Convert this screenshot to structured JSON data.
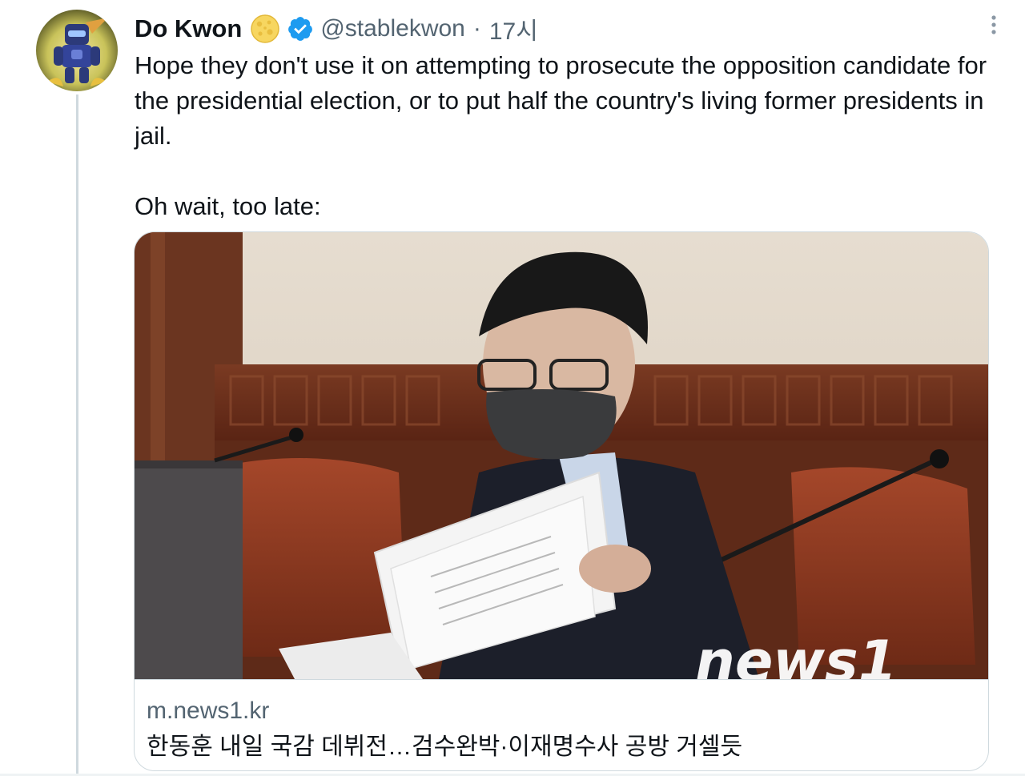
{
  "tweet": {
    "author": {
      "display_name": "Do Kwon",
      "handle": "@stablekwon",
      "badge_emoji_icon": "cheese-moon-emoji-icon",
      "verified_icon": "verified-badge-icon",
      "avatar_icon": "robot-avatar"
    },
    "separator": "·",
    "time": "17시",
    "more_icon": "more-vertical-icon",
    "text_paragraphs": [
      "Hope they don't use it on attempting to prosecute the opposition candidate for the presidential election, or to put half the country's living former presidents in jail.",
      "Oh wait, too late:"
    ],
    "card": {
      "image_description_icon": "news-photo",
      "domain": "m.news1.kr",
      "title": "한동훈 내일 국감 데뷔전…검수완박·이재명수사 공방 거셀듯",
      "watermark": "news1"
    }
  },
  "colors": {
    "text": "#0f1419",
    "secondary_text": "#536471",
    "verified_blue": "#1d9bf0",
    "border": "#cfd9de"
  }
}
